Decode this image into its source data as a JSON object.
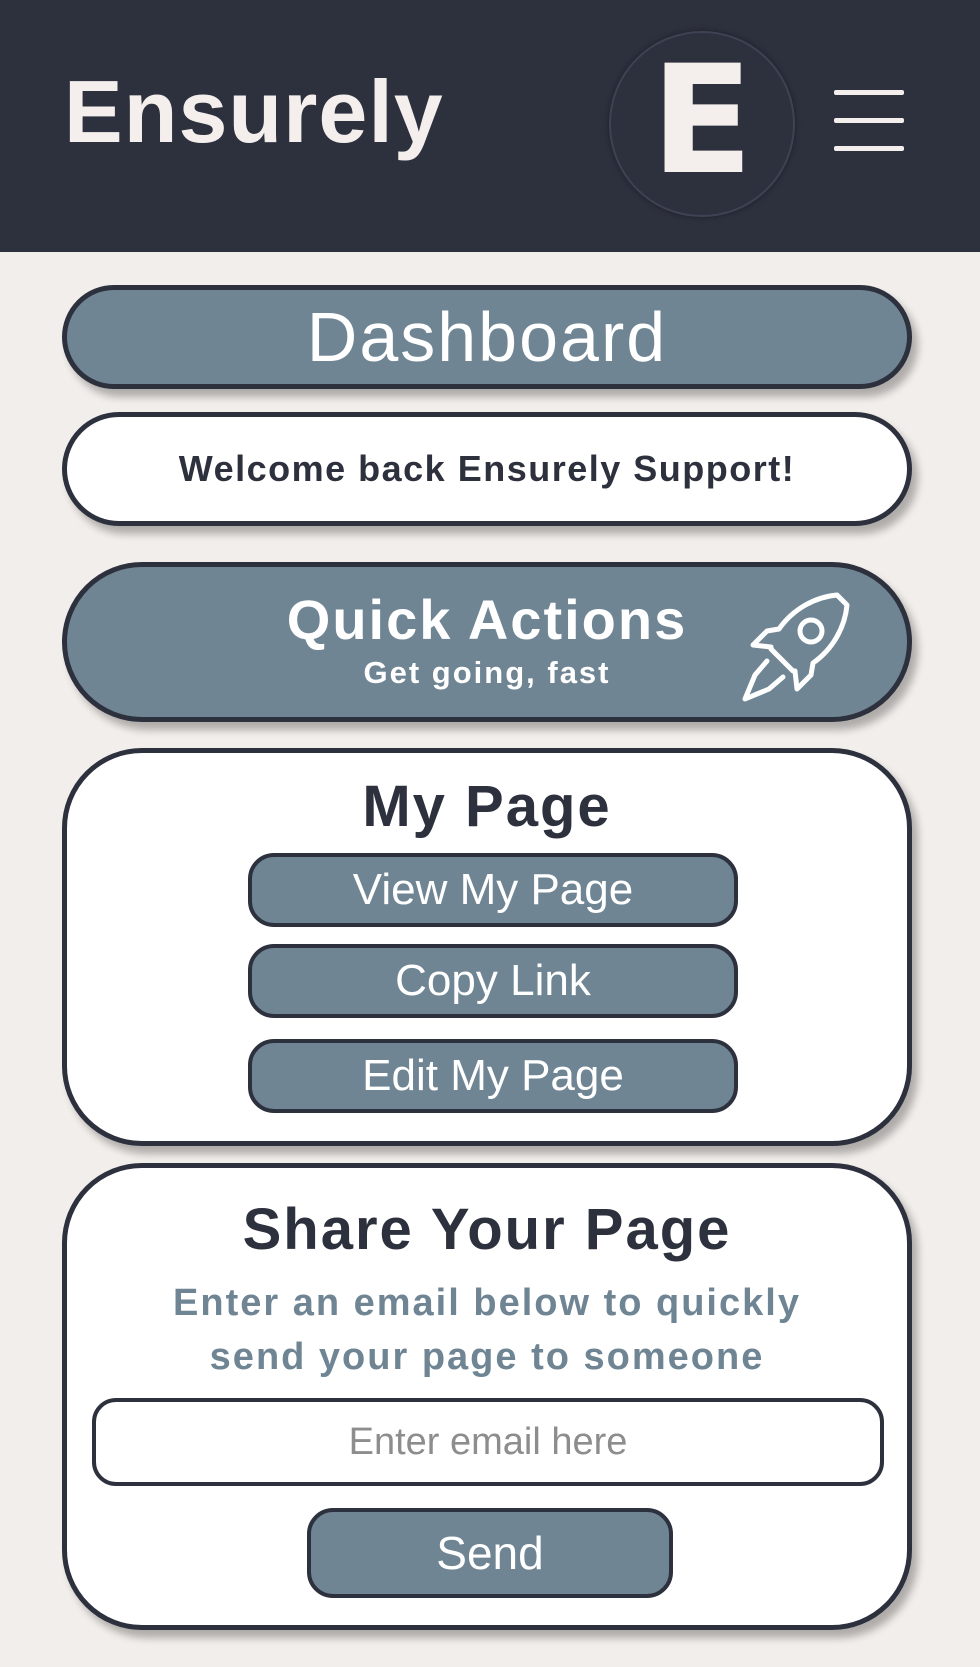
{
  "header": {
    "app_title": "Ensurely",
    "logo_letter": "E",
    "menu_icon": "hamburger-menu-icon"
  },
  "dashboard": {
    "label": "Dashboard"
  },
  "welcome": {
    "text": "Welcome back Ensurely Support!"
  },
  "quick_actions": {
    "title": "Quick Actions",
    "subtitle": "Get going, fast",
    "icon": "rocket-icon"
  },
  "my_page": {
    "title": "My Page",
    "buttons": [
      {
        "label": "View My Page"
      },
      {
        "label": "Copy Link"
      },
      {
        "label": "Edit My Page"
      }
    ]
  },
  "share": {
    "title": "Share Your Page",
    "description_line1": "Enter an email below to quickly",
    "description_line2": "send your page to someone",
    "email_placeholder": "Enter email here",
    "email_value": "",
    "send_label": "Send"
  },
  "colors": {
    "header_bg": "#2d303d",
    "page_bg": "#f2eeeb",
    "accent_blue": "#6f8594",
    "text_light": "#f4efec",
    "card_white": "#ffffff"
  }
}
